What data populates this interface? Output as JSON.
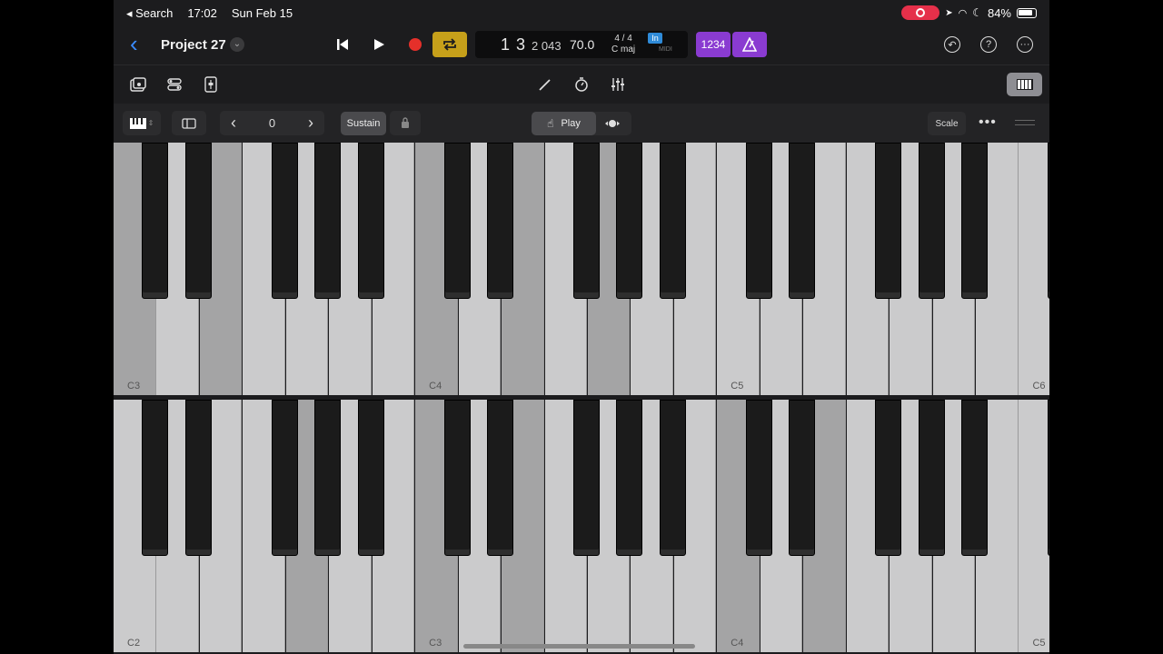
{
  "status_bar": {
    "back_app": "◂ Search",
    "time": "17:02",
    "date": "Sun Feb 15",
    "battery": "84%"
  },
  "header": {
    "project_title": "Project 27"
  },
  "lcd": {
    "bar": "1 3",
    "ticks": "2 043",
    "tempo": "70.0",
    "time_signature": "4 / 4",
    "key": "C maj",
    "in_badge": "In",
    "midi_label": "MIDI"
  },
  "count_in_label": "1234",
  "keyboard_controls": {
    "octave_value": "0",
    "sustain_label": "Sustain",
    "play_label": "Play",
    "scale_label": "Scale"
  },
  "keyboard_top": {
    "labels": [
      "C3",
      "C4",
      "C5",
      "C6"
    ],
    "pressed_white_indices": [
      0,
      2,
      7,
      9,
      11
    ]
  },
  "keyboard_bottom": {
    "labels": [
      "C2",
      "C3",
      "C4",
      "C5"
    ],
    "pressed_white_indices": [
      4,
      7,
      9,
      14,
      16
    ]
  },
  "accent_colors": {
    "loop": "#c6a01a",
    "purple": "#8a3bd1",
    "record": "#e5302a",
    "back": "#3b8cff"
  }
}
